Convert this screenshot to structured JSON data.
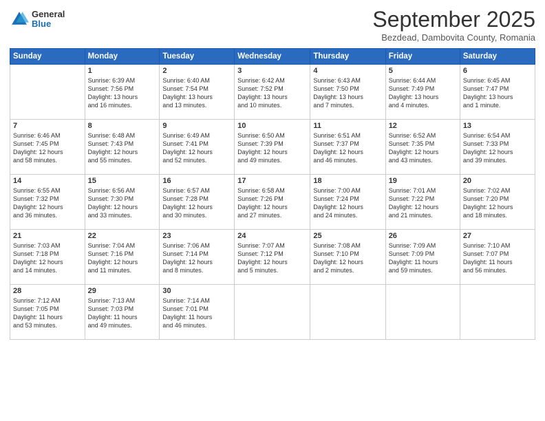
{
  "header": {
    "logo_general": "General",
    "logo_blue": "Blue",
    "month_title": "September 2025",
    "subtitle": "Bezdead, Dambovita County, Romania"
  },
  "days_of_week": [
    "Sunday",
    "Monday",
    "Tuesday",
    "Wednesday",
    "Thursday",
    "Friday",
    "Saturday"
  ],
  "weeks": [
    [
      {
        "num": "",
        "info": ""
      },
      {
        "num": "1",
        "info": "Sunrise: 6:39 AM\nSunset: 7:56 PM\nDaylight: 13 hours\nand 16 minutes."
      },
      {
        "num": "2",
        "info": "Sunrise: 6:40 AM\nSunset: 7:54 PM\nDaylight: 13 hours\nand 13 minutes."
      },
      {
        "num": "3",
        "info": "Sunrise: 6:42 AM\nSunset: 7:52 PM\nDaylight: 13 hours\nand 10 minutes."
      },
      {
        "num": "4",
        "info": "Sunrise: 6:43 AM\nSunset: 7:50 PM\nDaylight: 13 hours\nand 7 minutes."
      },
      {
        "num": "5",
        "info": "Sunrise: 6:44 AM\nSunset: 7:49 PM\nDaylight: 13 hours\nand 4 minutes."
      },
      {
        "num": "6",
        "info": "Sunrise: 6:45 AM\nSunset: 7:47 PM\nDaylight: 13 hours\nand 1 minute."
      }
    ],
    [
      {
        "num": "7",
        "info": "Sunrise: 6:46 AM\nSunset: 7:45 PM\nDaylight: 12 hours\nand 58 minutes."
      },
      {
        "num": "8",
        "info": "Sunrise: 6:48 AM\nSunset: 7:43 PM\nDaylight: 12 hours\nand 55 minutes."
      },
      {
        "num": "9",
        "info": "Sunrise: 6:49 AM\nSunset: 7:41 PM\nDaylight: 12 hours\nand 52 minutes."
      },
      {
        "num": "10",
        "info": "Sunrise: 6:50 AM\nSunset: 7:39 PM\nDaylight: 12 hours\nand 49 minutes."
      },
      {
        "num": "11",
        "info": "Sunrise: 6:51 AM\nSunset: 7:37 PM\nDaylight: 12 hours\nand 46 minutes."
      },
      {
        "num": "12",
        "info": "Sunrise: 6:52 AM\nSunset: 7:35 PM\nDaylight: 12 hours\nand 43 minutes."
      },
      {
        "num": "13",
        "info": "Sunrise: 6:54 AM\nSunset: 7:33 PM\nDaylight: 12 hours\nand 39 minutes."
      }
    ],
    [
      {
        "num": "14",
        "info": "Sunrise: 6:55 AM\nSunset: 7:32 PM\nDaylight: 12 hours\nand 36 minutes."
      },
      {
        "num": "15",
        "info": "Sunrise: 6:56 AM\nSunset: 7:30 PM\nDaylight: 12 hours\nand 33 minutes."
      },
      {
        "num": "16",
        "info": "Sunrise: 6:57 AM\nSunset: 7:28 PM\nDaylight: 12 hours\nand 30 minutes."
      },
      {
        "num": "17",
        "info": "Sunrise: 6:58 AM\nSunset: 7:26 PM\nDaylight: 12 hours\nand 27 minutes."
      },
      {
        "num": "18",
        "info": "Sunrise: 7:00 AM\nSunset: 7:24 PM\nDaylight: 12 hours\nand 24 minutes."
      },
      {
        "num": "19",
        "info": "Sunrise: 7:01 AM\nSunset: 7:22 PM\nDaylight: 12 hours\nand 21 minutes."
      },
      {
        "num": "20",
        "info": "Sunrise: 7:02 AM\nSunset: 7:20 PM\nDaylight: 12 hours\nand 18 minutes."
      }
    ],
    [
      {
        "num": "21",
        "info": "Sunrise: 7:03 AM\nSunset: 7:18 PM\nDaylight: 12 hours\nand 14 minutes."
      },
      {
        "num": "22",
        "info": "Sunrise: 7:04 AM\nSunset: 7:16 PM\nDaylight: 12 hours\nand 11 minutes."
      },
      {
        "num": "23",
        "info": "Sunrise: 7:06 AM\nSunset: 7:14 PM\nDaylight: 12 hours\nand 8 minutes."
      },
      {
        "num": "24",
        "info": "Sunrise: 7:07 AM\nSunset: 7:12 PM\nDaylight: 12 hours\nand 5 minutes."
      },
      {
        "num": "25",
        "info": "Sunrise: 7:08 AM\nSunset: 7:10 PM\nDaylight: 12 hours\nand 2 minutes."
      },
      {
        "num": "26",
        "info": "Sunrise: 7:09 AM\nSunset: 7:09 PM\nDaylight: 11 hours\nand 59 minutes."
      },
      {
        "num": "27",
        "info": "Sunrise: 7:10 AM\nSunset: 7:07 PM\nDaylight: 11 hours\nand 56 minutes."
      }
    ],
    [
      {
        "num": "28",
        "info": "Sunrise: 7:12 AM\nSunset: 7:05 PM\nDaylight: 11 hours\nand 53 minutes."
      },
      {
        "num": "29",
        "info": "Sunrise: 7:13 AM\nSunset: 7:03 PM\nDaylight: 11 hours\nand 49 minutes."
      },
      {
        "num": "30",
        "info": "Sunrise: 7:14 AM\nSunset: 7:01 PM\nDaylight: 11 hours\nand 46 minutes."
      },
      {
        "num": "",
        "info": ""
      },
      {
        "num": "",
        "info": ""
      },
      {
        "num": "",
        "info": ""
      },
      {
        "num": "",
        "info": ""
      }
    ]
  ]
}
